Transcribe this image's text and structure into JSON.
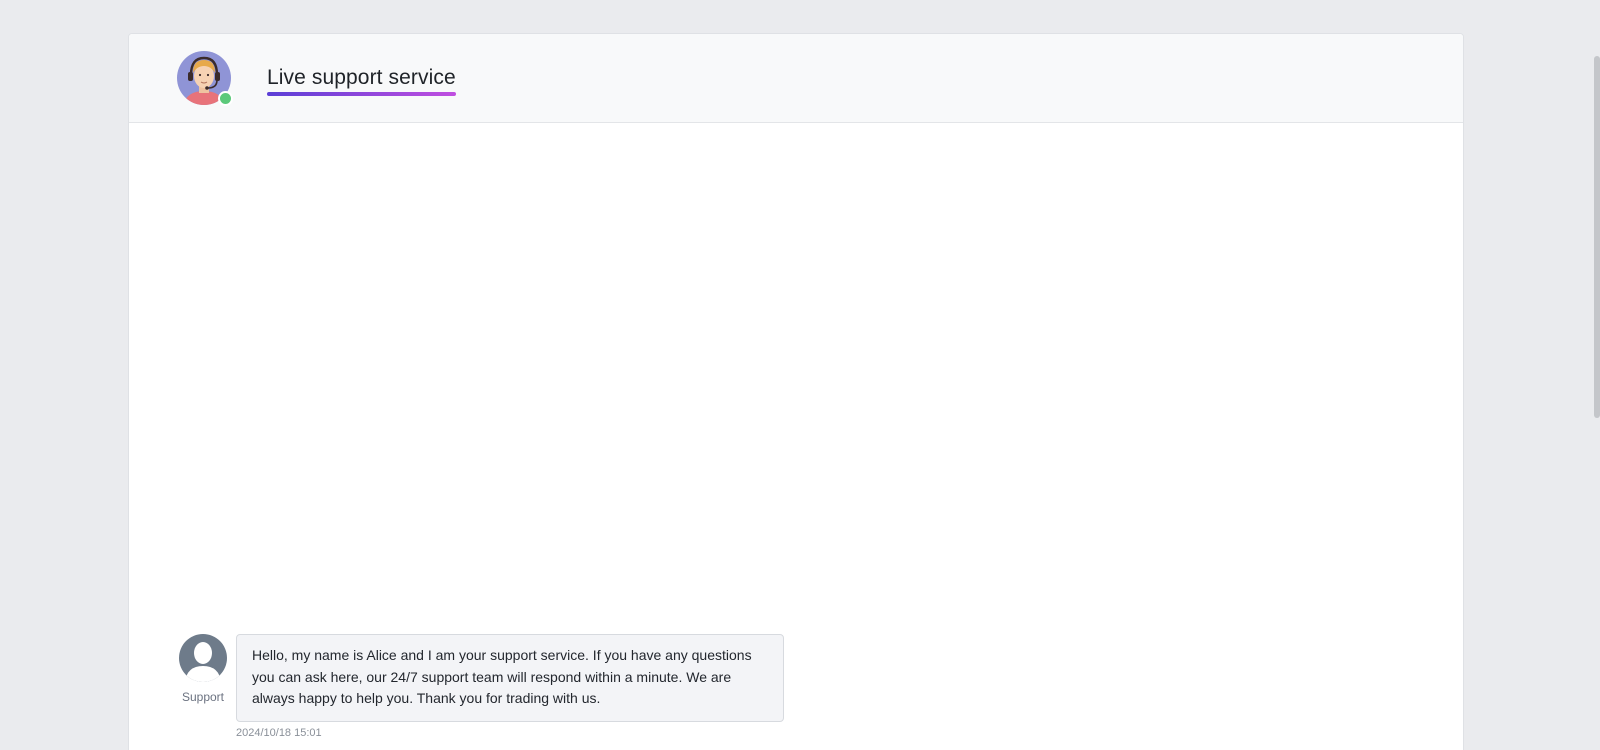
{
  "header": {
    "title": "Live support service",
    "agent_status": "online"
  },
  "message": {
    "sender": "Support",
    "text": "Hello, my name is Alice and I am your support service. If you have any questions you can ask here, our 24/7 support team will respond within a minute. We are always happy to help you. Thank you for trading with us.",
    "timestamp": "2024/10/18 15:01"
  },
  "colors": {
    "title_gradient_start": "#5b3fd6",
    "title_gradient_end": "#c04ee0",
    "online_indicator": "#5cc97b"
  }
}
